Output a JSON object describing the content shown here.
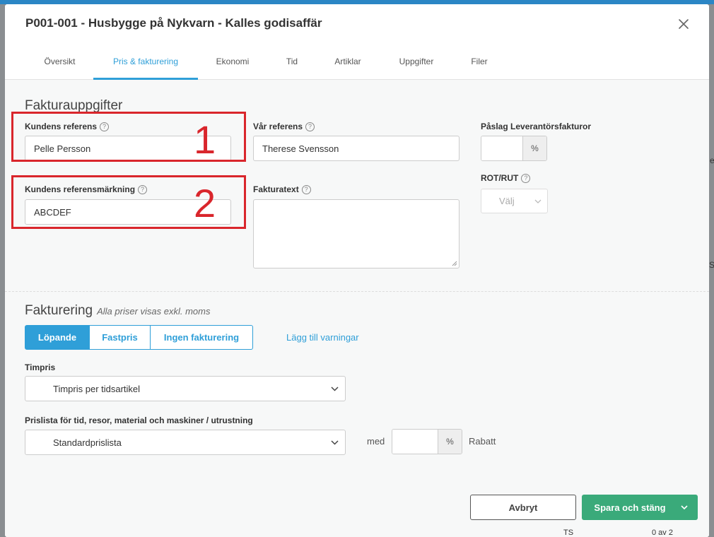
{
  "modal": {
    "title": "P001-001 - Husbygge på Nykvarn - Kalles godisaffär"
  },
  "tabs": [
    {
      "label": "Översikt"
    },
    {
      "label": "Pris & fakturering",
      "active": true
    },
    {
      "label": "Ekonomi"
    },
    {
      "label": "Tid"
    },
    {
      "label": "Artiklar"
    },
    {
      "label": "Uppgifter"
    },
    {
      "label": "Filer"
    }
  ],
  "invoice_details": {
    "section_title": "Fakturauppgifter",
    "customer_reference": {
      "label": "Kundens referens",
      "value": "Pelle Persson"
    },
    "customer_reference_marking": {
      "label": "Kundens referensmärkning",
      "value": "ABCDEF"
    },
    "our_reference": {
      "label": "Vår referens",
      "value": "Therese Svensson"
    },
    "invoice_text": {
      "label": "Fakturatext",
      "value": ""
    },
    "supplier_markup": {
      "label": "Påslag Leverantörsfakturor",
      "value": "",
      "unit": "%"
    },
    "rot_rut": {
      "label": "ROT/RUT",
      "placeholder": "Välj"
    }
  },
  "billing": {
    "section_title": "Fakturering",
    "hint": "Alla priser visas exkl. moms",
    "modes": [
      {
        "label": "Löpande",
        "active": true
      },
      {
        "label": "Fastpris"
      },
      {
        "label": "Ingen fakturering"
      }
    ],
    "add_warnings_link": "Lägg till varningar",
    "hourly_rate": {
      "label": "Timpris",
      "value": "Timpris per tidsartikel"
    },
    "price_list": {
      "label": "Prislista för tid, resor, material och maskiner / utrustning",
      "value": "Standardprislista",
      "with_label": "med",
      "discount_value": "",
      "discount_unit": "%",
      "discount_label": "Rabatt"
    }
  },
  "footer": {
    "cancel_label": "Avbryt",
    "save_label": "Spara och stäng"
  },
  "annotations": [
    {
      "number": "1"
    },
    {
      "number": "2"
    }
  ],
  "colors": {
    "accent": "#2f9fd8",
    "success": "#3aaa7a",
    "annotation": "#d9262c"
  },
  "background_fragments": {
    "right_1": "ek",
    "right_2": "S",
    "bottom_1": "0 av 2",
    "bottom_2": "TS"
  }
}
